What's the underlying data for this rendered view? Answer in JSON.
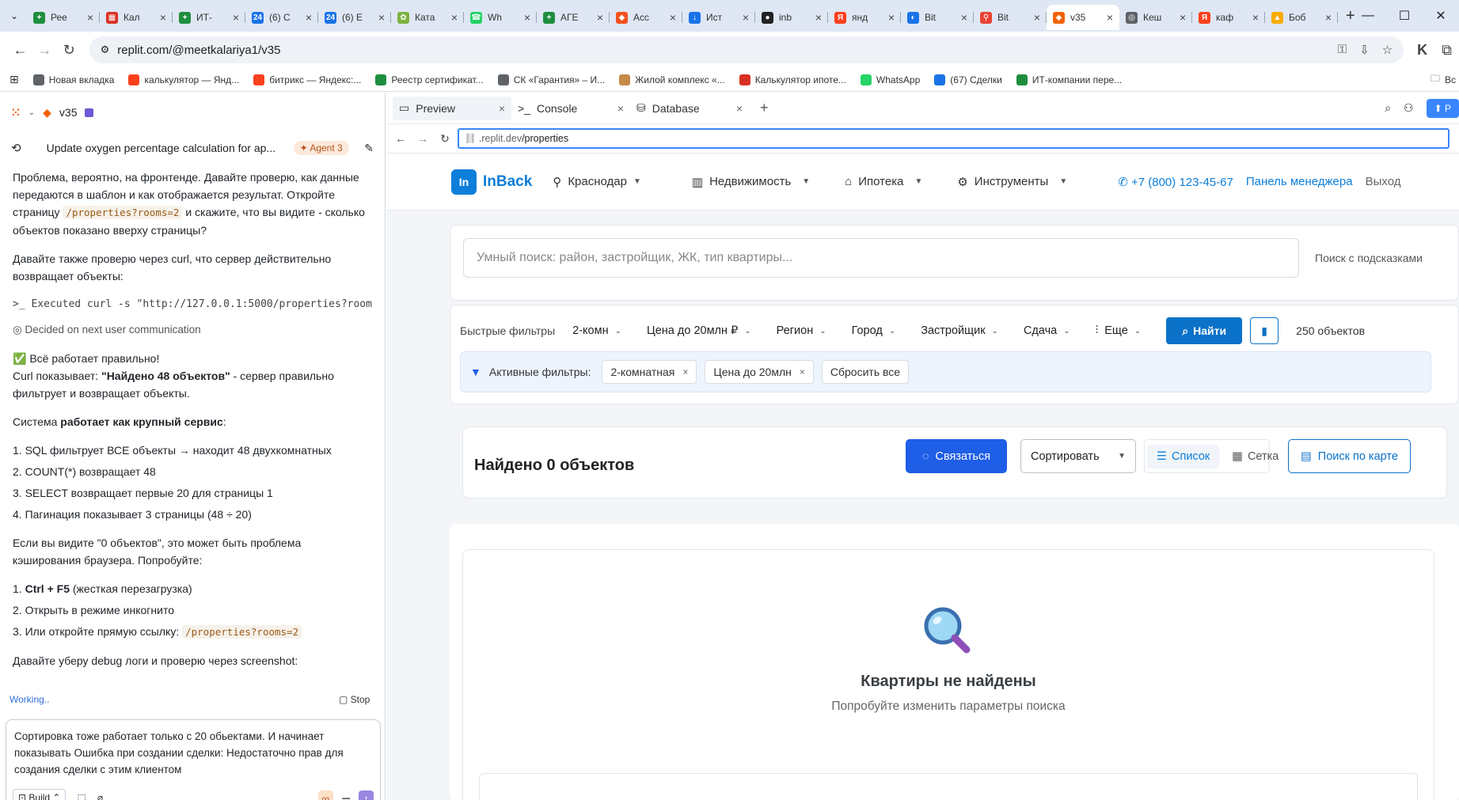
{
  "browser": {
    "tabs": [
      {
        "title": "Рее",
        "fav": "#1e8e3e",
        "glyph": "+"
      },
      {
        "title": "Кал",
        "fav": "#d93025",
        "glyph": "▦"
      },
      {
        "title": "ИТ-",
        "fav": "#1e8e3e",
        "glyph": "+"
      },
      {
        "title": "(6) С",
        "fav": "#1a73e8",
        "glyph": "24"
      },
      {
        "title": "(6) Е",
        "fav": "#1a73e8",
        "glyph": "24"
      },
      {
        "title": "Ката",
        "fav": "#7cb342",
        "glyph": "✿"
      },
      {
        "title": "Wh",
        "fav": "#25d366",
        "glyph": "☎"
      },
      {
        "title": "АГЕ",
        "fav": "#1e8e3e",
        "glyph": "+"
      },
      {
        "title": "Acc",
        "fav": "#f4511e",
        "glyph": "◆"
      },
      {
        "title": "Ист",
        "fav": "#1a73e8",
        "glyph": "↓"
      },
      {
        "title": "inb",
        "fav": "#222222",
        "glyph": "●"
      },
      {
        "title": "янд",
        "fav": "#fc3f1d",
        "glyph": "Я"
      },
      {
        "title": "Bit",
        "fav": "#1a73e8",
        "glyph": "◐"
      },
      {
        "title": "Bit",
        "fav": "#ea4335",
        "glyph": "⚲"
      },
      {
        "title": "v35",
        "fav": "#f26207",
        "glyph": "◆",
        "active": true
      },
      {
        "title": "Кеш",
        "fav": "#5f6368",
        "glyph": "◎"
      },
      {
        "title": "каф",
        "fav": "#fc3f1d",
        "glyph": "Я"
      },
      {
        "title": "Боб",
        "fav": "#f9ab00",
        "glyph": "▲"
      }
    ],
    "url": "replit.com/@meetkalariya1/v35",
    "bookmarks": [
      {
        "label": "Новая вкладка",
        "color": "#5f6368"
      },
      {
        "label": "калькулятор — Янд...",
        "color": "#fc3f1d"
      },
      {
        "label": "битрикс — Яндекс:...",
        "color": "#fc3f1d"
      },
      {
        "label": "Реестр сертификат...",
        "color": "#1e8e3e"
      },
      {
        "label": "СК «Гарантия» – И...",
        "color": "#5f6368"
      },
      {
        "label": "Жилой комплекс «...",
        "color": "#c58a4a"
      },
      {
        "label": "Калькулятор ипоте...",
        "color": "#d93025"
      },
      {
        "label": "WhatsApp",
        "color": "#25d366"
      },
      {
        "label": "(67) Сделки",
        "color": "#1a73e8"
      },
      {
        "label": "ИТ-компании пере...",
        "color": "#1e8e3e"
      }
    ],
    "bookmarks_more": "Вс"
  },
  "replit": {
    "project": "v35",
    "thread_title": "Update oxygen percentage calculation for ap...",
    "agent_badge": "Agent 3",
    "chat": {
      "p1_a": "Проблема, вероятно, на фронтенде. Давайте проверю, как данные передаются в шаблон и как отображается результат. Откройте страницу ",
      "p1_code": "/properties?rooms=2",
      "p1_b": " и скажите, что вы видите - сколько объектов показано вверху страницы?",
      "p2": "Давайте также проверю через curl, что сервер действительно возвращает объекты:",
      "exec": ">_ Executed curl -s \"http://127.0.0.1:5000/properties?room...",
      "decided": "Decided on next user communication",
      "ok_line": "✅ Всё работает правильно!",
      "curl_a": "Curl показывает: ",
      "curl_bold": "\"Найдено 48 объектов\"",
      "curl_b": " - сервер правильно фильтрует и возвращает объекты.",
      "sys_a": "Система ",
      "sys_bold": "работает как крупный сервис",
      "sys_b": ":",
      "list1": [
        "1. SQL фильтрует ВСЕ объекты → находит 48 двухкомнатных",
        "2. COUNT(*) возвращает 48",
        "3. SELECT возвращает первые 20 для страницы 1",
        "4. Пагинация показывает 3 страницы (48 ÷ 20)"
      ],
      "p3": "Если вы видите \"0 объектов\", это может быть проблема кэширования браузера. Попробуйте:",
      "l2_1_bold": "Ctrl + F5",
      "l2_1_rest": " (жесткая перезагрузка)",
      "l2_2": "2. Открыть в режиме инкогнито",
      "l2_3": "3. Или откройте прямую ссылку: ",
      "l2_3_code": "/properties?rooms=2",
      "p4": "Давайте уберу debug логи и проверю через screenshot:"
    },
    "working": "Working..",
    "stop": "Stop",
    "input_text": "Сортировка тоже работает только с 20 обьектами. И начинает показывать Ошибка при создании сделки: Недостаточно прав для создания сделки с этим клиентом",
    "build_label": "Build",
    "tabs": [
      "Preview",
      "Console",
      "Database"
    ],
    "preview_url_prefix": ".replit.dev",
    "preview_url_path": "/properties",
    "publish_label": "P"
  },
  "site": {
    "logo_mark": "In",
    "logo_name": "InBack",
    "city": "Краснодар",
    "nav": [
      "Недвижимость",
      "Ипотека",
      "Инструменты"
    ],
    "phone": "+7 (800) 123-45-67",
    "manager_panel": "Панель менеджера",
    "logout": "Выход",
    "search_placeholder": "Умный поиск: район, застройщик, ЖК, тип квартиры...",
    "search_hint": "Поиск с подсказками",
    "quick_filters_label": "Быстрые фильтры",
    "filters": [
      "2-комн",
      "Цена до 20млн ₽",
      "Регион",
      "Город",
      "Застройщик",
      "Сдача"
    ],
    "more_filter": "Еще",
    "find_button": "Найти",
    "objects_count": "250 объектов",
    "active_filters_label": "Активные фильтры:",
    "active_chips": [
      "2-комнатная",
      "Цена до 20млн"
    ],
    "reset_all": "Сбросить все",
    "found_title": "Найдено 0 объектов",
    "contact_button": "Связаться",
    "sort_label": "Сортировать",
    "view_list": "Список",
    "view_grid": "Сетка",
    "map_search": "Поиск по карте",
    "empty_title": "Квартиры не найдены",
    "empty_subtitle": "Попробуйте изменить параметры поиска"
  }
}
